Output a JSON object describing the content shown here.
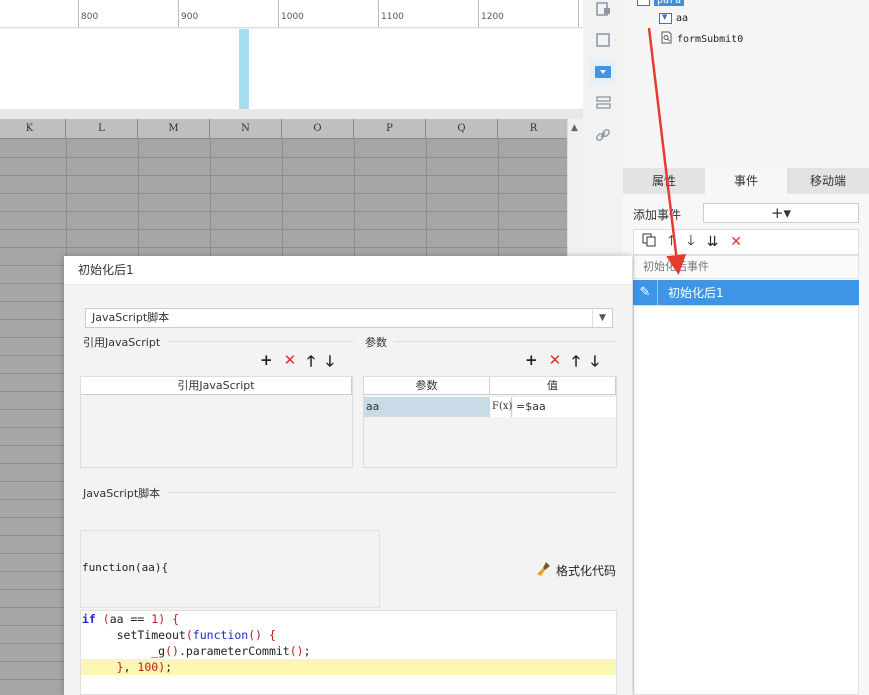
{
  "ruler": {
    "ticks": [
      "800",
      "900",
      "1000",
      "1100",
      "1200"
    ]
  },
  "sheet": {
    "columns": [
      "K",
      "L",
      "M",
      "N",
      "O",
      "P",
      "Q",
      "R"
    ]
  },
  "tree": {
    "root_label": "para",
    "items": [
      {
        "label": "aa",
        "icon": "dropdown-widget-icon"
      },
      {
        "label": "formSubmit0",
        "icon": "search-doc-icon"
      }
    ]
  },
  "tabs": [
    {
      "label": "属性",
      "active": false
    },
    {
      "label": "事件",
      "active": true
    },
    {
      "label": "移动端",
      "active": false
    }
  ],
  "events": {
    "add_label": "添加事件",
    "add_button": "+▾",
    "group_label": "初始化后事件",
    "selected_item": "初始化后1"
  },
  "dialog": {
    "title": "初始化后1",
    "type_select": "JavaScript脚本",
    "ref_js": {
      "title": "引用JavaScript",
      "column": "引用JavaScript"
    },
    "params": {
      "title": "参数",
      "columns": [
        "参数",
        "值"
      ],
      "rows": [
        {
          "name": "aa",
          "formula": "F(x)",
          "value": "=$aa"
        }
      ]
    },
    "script": {
      "title": "JavaScript脚本",
      "signature": "function(aa){",
      "format_button": "格式化代码",
      "lines": [
        "if (aa == 1) {",
        "    setTimeout(function() {",
        "        _g().parameterCommit();",
        "    }, 100);",
        "",
        "}"
      ]
    }
  },
  "colors": {
    "accent": "#3e95e6",
    "delete_red": "#e0302a",
    "annotation_arrow": "#e53b30",
    "sheet_gray": "#a6a6a6",
    "highlight_line": "#fbf7b3"
  }
}
